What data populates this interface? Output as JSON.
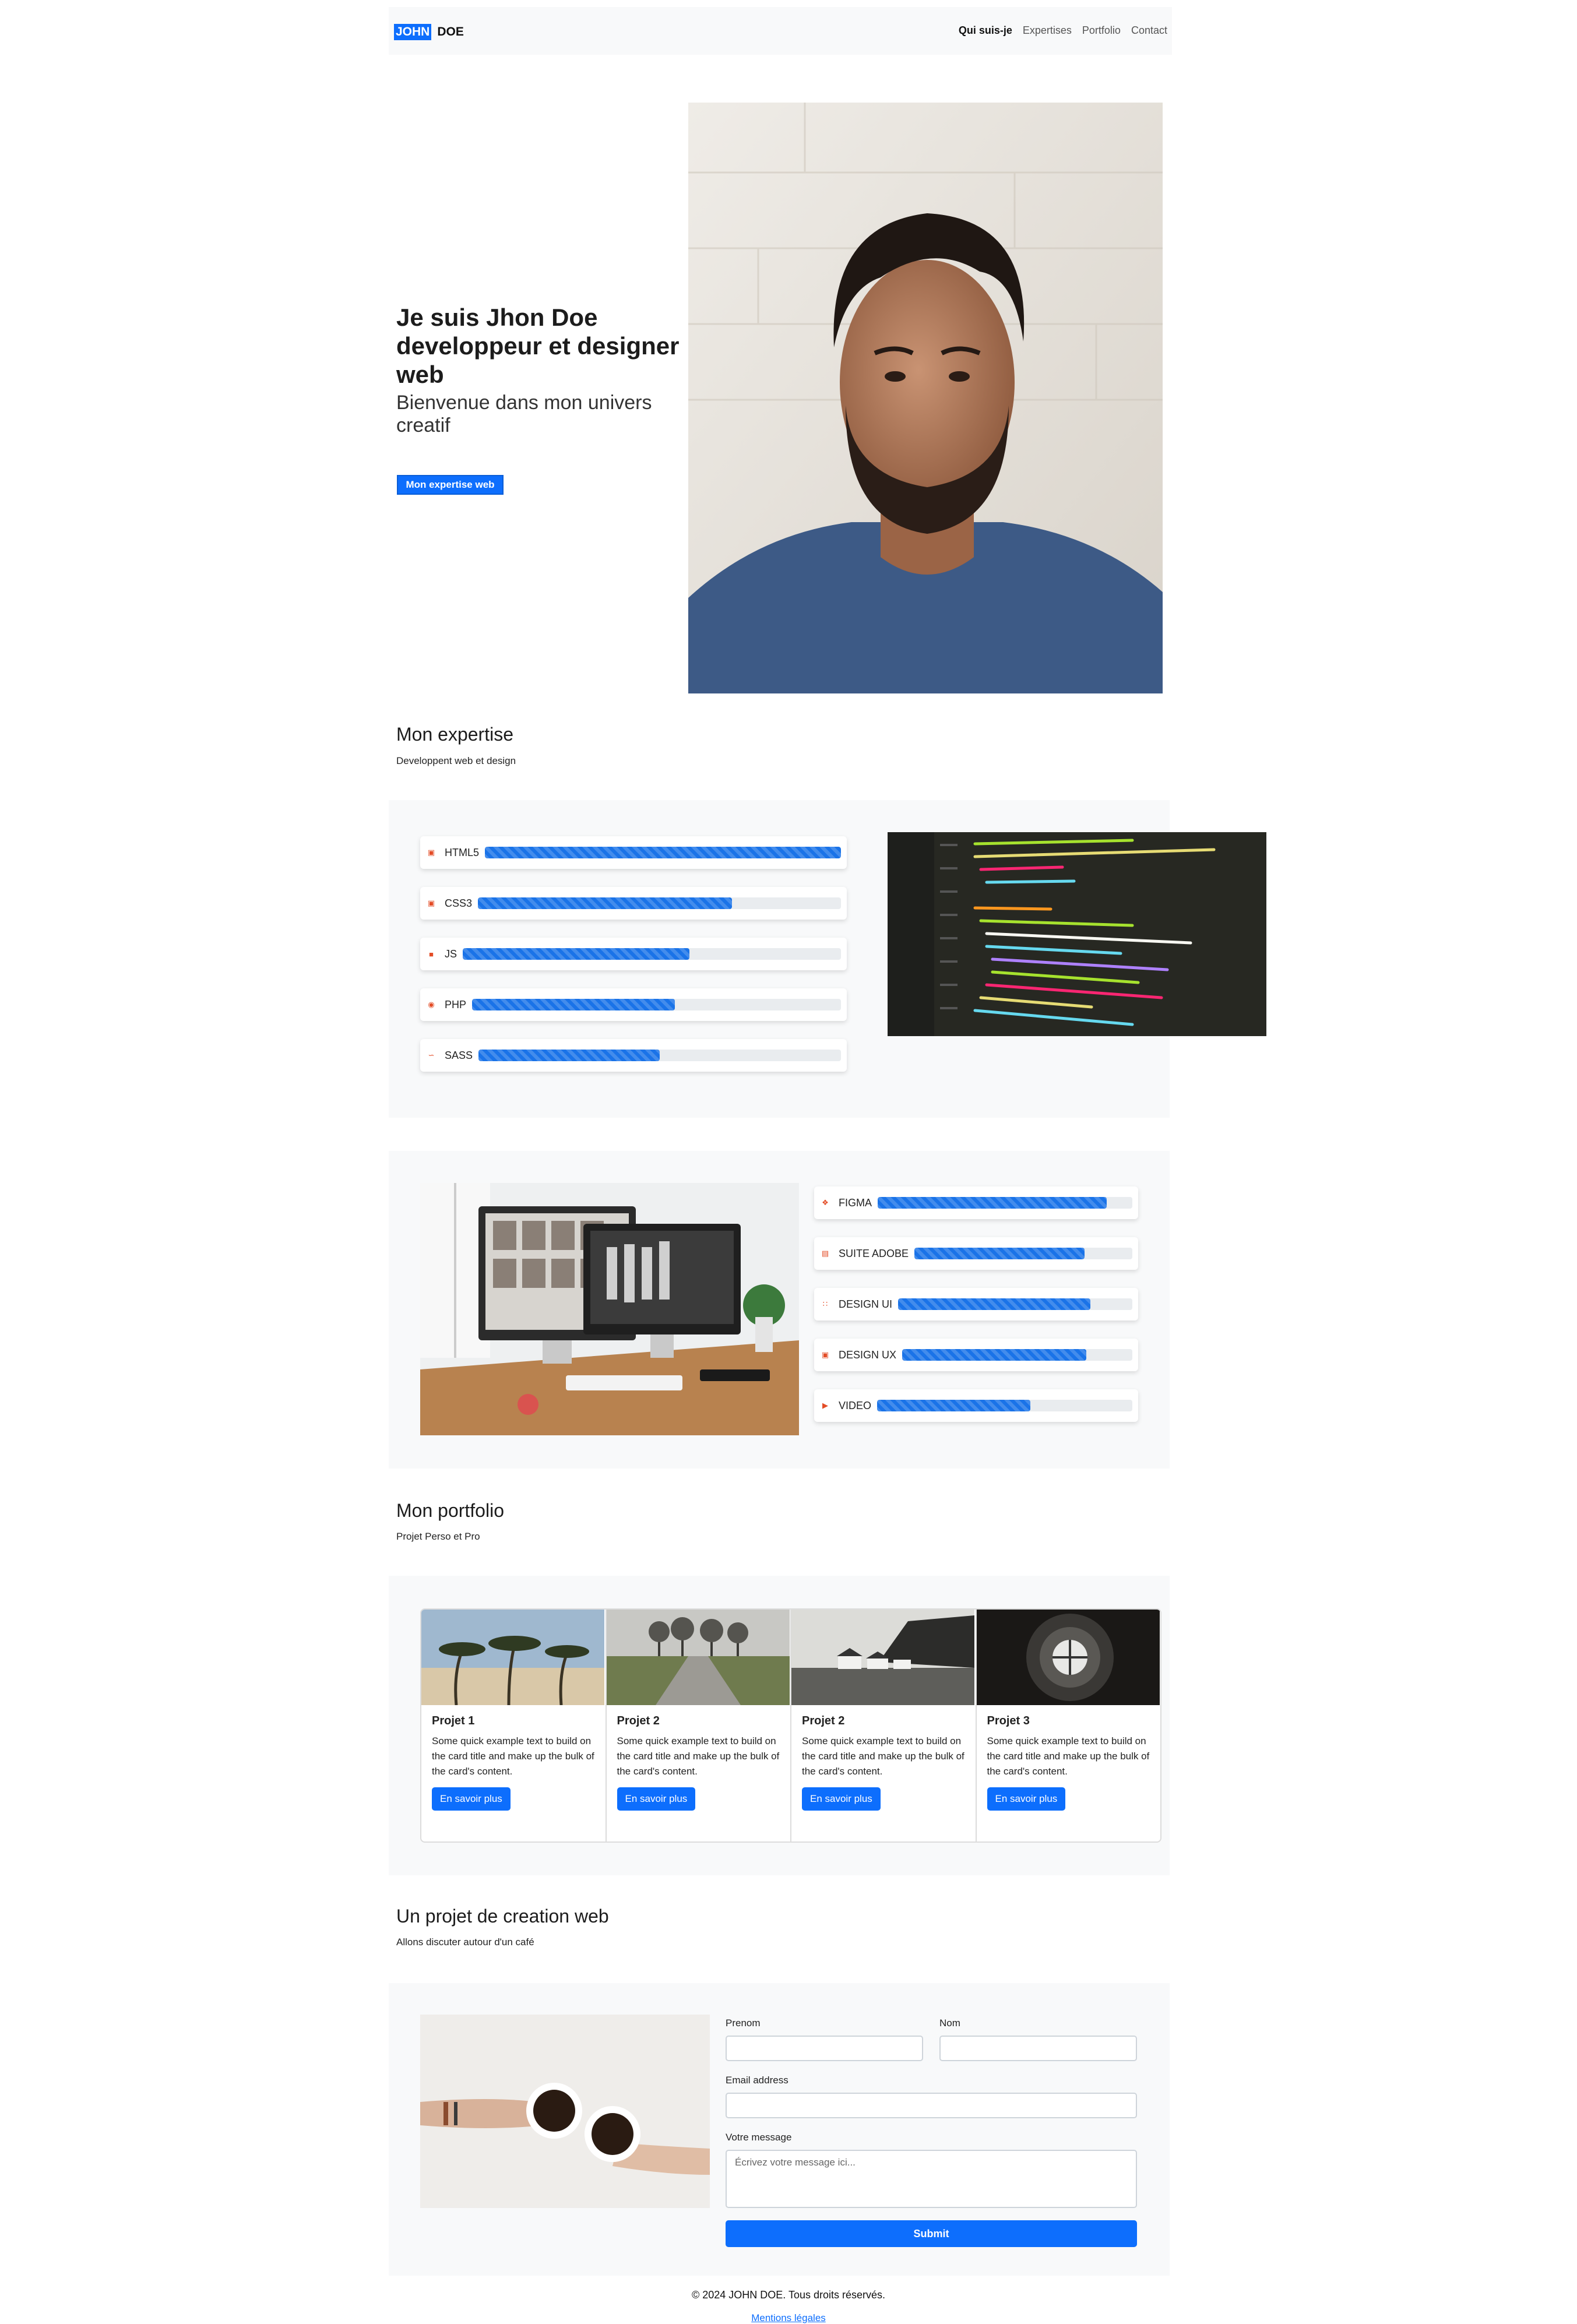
{
  "nav": {
    "brand_first": "JOHN",
    "brand_last": "DOE",
    "links": [
      "Qui suis-je",
      "Expertises",
      "Portfolio",
      "Contact"
    ]
  },
  "hero": {
    "title": "Je suis Jhon Doe developpeur et designer web",
    "subtitle": "Bienvenue dans mon univers creatif",
    "button": "Mon expertise web"
  },
  "expertise": {
    "title": "Mon expertise",
    "subtitle": "Developpent web et design",
    "dev_skills": [
      {
        "label": "HTML5",
        "icon": "html5-icon",
        "level": 1.0
      },
      {
        "label": "CSS3",
        "icon": "css3-icon",
        "level": 0.7
      },
      {
        "label": "JS",
        "icon": "js-icon",
        "level": 0.6
      },
      {
        "label": "PHP",
        "icon": "php-icon",
        "level": 0.55
      },
      {
        "label": "SASS",
        "icon": "sass-icon",
        "level": 0.5
      }
    ],
    "design_skills": [
      {
        "label": "FIGMA",
        "icon": "figma-icon",
        "level": 0.9
      },
      {
        "label": "SUITE ADOBE",
        "icon": "adobe-icon",
        "level": 0.78
      },
      {
        "label": "DESIGN UI",
        "icon": "design-ui-icon",
        "level": 0.82
      },
      {
        "label": "DESIGN UX",
        "icon": "design-ux-icon",
        "level": 0.8
      },
      {
        "label": "VIDEO",
        "icon": "video-icon",
        "level": 0.6
      }
    ]
  },
  "portfolio": {
    "title": "Mon portfolio",
    "subtitle": "Projet Perso et Pro",
    "cards": [
      {
        "title": "Projet 1",
        "text": "Some quick example text to build on the card title and make up the bulk of the card's content.",
        "button": "En savoir plus"
      },
      {
        "title": "Projet 2",
        "text": "Some quick example text to build on the card title and make up the bulk of the card's content.",
        "button": "En savoir plus"
      },
      {
        "title": "Projet 2",
        "text": "Some quick example text to build on the card title and make up the bulk of the card's content.",
        "button": "En savoir plus"
      },
      {
        "title": "Projet 3",
        "text": "Some quick example text to build on the card title and make up the bulk of the card's content.",
        "button": "En savoir plus"
      }
    ]
  },
  "contact": {
    "title": "Un projet de creation web",
    "subtitle": "Allons discuter autour d'un café",
    "prenom_label": "Prenom",
    "nom_label": "Nom",
    "email_label": "Email address",
    "message_label": "Votre message",
    "message_placeholder": "Écrivez votre message ici...",
    "submit": "Submit"
  },
  "footer": {
    "copyright": "© 2024 JOHN DOE. Tous droits réservés.",
    "legal": "Mentions légales",
    "social_icons": [
      "instagram-icon",
      "x-icon",
      "linkedin-icon"
    ]
  },
  "colors": {
    "primary": "#0d6efd",
    "bar": "#1a73e8",
    "panel": "#f8f9fa",
    "icon_accent": "#e34c26"
  }
}
